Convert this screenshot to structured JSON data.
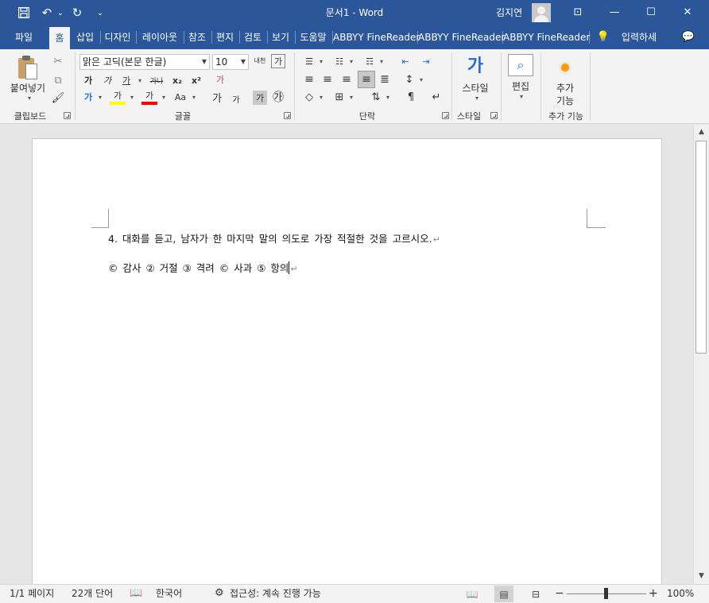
{
  "titlebar": {
    "doc_title": "문서1  -  Word",
    "user_name": "김지연",
    "save_icon": "💾",
    "undo_icon": "↶",
    "undo_dd": "⌄",
    "redo_icon": "↻",
    "customize_icon": "⌄",
    "ribbon_display_icon": "⊡",
    "minimize_icon": "—",
    "maximize_icon": "☐",
    "close_icon": "✕"
  },
  "tabs": {
    "file": "파일",
    "home": "홈",
    "insert": "삽입",
    "design": "디자인",
    "layout": "레이아웃",
    "references": "참조",
    "mailings": "편지",
    "review": "검토",
    "view": "보기",
    "help": "도움말",
    "abbyy1": "ABBYY FineReader",
    "abbyy2": "ABBYY FineReader",
    "abbyy3": "ABBYY FineReader",
    "tellme": "입력하세",
    "tellme_icon": "💡",
    "comments_icon": "💬"
  },
  "ribbon": {
    "clipboard": {
      "label": "클립보드",
      "paste": "붙여넣기",
      "cut_icon": "✂",
      "copy_icon": "⧉",
      "format_painter_icon": "🖌"
    },
    "font": {
      "label": "글꼴",
      "font_name": "맑은 고딕(본문 한글)",
      "font_size": "10",
      "grow_icon": "가",
      "shrink_icon": "가",
      "bold": "가",
      "italic": "가",
      "underline": "가",
      "strikethrough": "가나",
      "subscript": "x₂",
      "superscript": "x²",
      "clear_format": "가",
      "text_effects": "가",
      "highlight": "가",
      "font_color": "가",
      "change_case": "Aa",
      "phonetic": "가",
      "char_border": "가",
      "char_shading": "가",
      "enclose": "㉮",
      "ruby": "내천",
      "char_scale": "가"
    },
    "paragraph": {
      "label": "단락",
      "bullets_icon": "☰",
      "numbering_icon": "☷",
      "multilevel_icon": "☶",
      "dec_indent_icon": "⇤",
      "inc_indent_icon": "⇥",
      "align_left_icon": "≡",
      "center_icon": "≡",
      "align_right_icon": "≡",
      "justify_icon": "≡",
      "distributed_icon": "≣",
      "line_spacing_icon": "↕",
      "shading_icon": "◇",
      "borders_icon": "⊞",
      "sort_icon": "⇅",
      "show_marks_icon": "¶",
      "text_direction_icon": "↵"
    },
    "styles": {
      "label": "스타일",
      "button": "스타일",
      "icon": "가"
    },
    "editing": {
      "button": "편집",
      "icon": "⌕"
    },
    "addins": {
      "label": "추가 기능",
      "button_line1": "추가",
      "button_line2": "기능"
    }
  },
  "document": {
    "line1": "4. 대화를 듣고, 남자가 한 마지막 말의 의도로 가장 적절한 것을 고르시오.",
    "line2": "© 감사 ② 거절 ③ 격려 © 사과 ⑤ 항의",
    "paragraph_mark": "↵"
  },
  "statusbar": {
    "page": "1/1 페이지",
    "words": "22개 단어",
    "proofing_icon": "📖",
    "language": "한국어",
    "accessibility_icon": "⚙",
    "accessibility": "접근성: 계속 진행 가능",
    "read_mode_icon": "📖",
    "print_layout_icon": "▤",
    "web_layout_icon": "⊟",
    "zoom_out": "−",
    "zoom_in": "+",
    "zoom": "100%",
    "zoom_level": 100
  },
  "colors": {
    "accent": "#2b579a",
    "highlight_bar": "#ffff00",
    "font_color_bar": "#ff0000"
  }
}
